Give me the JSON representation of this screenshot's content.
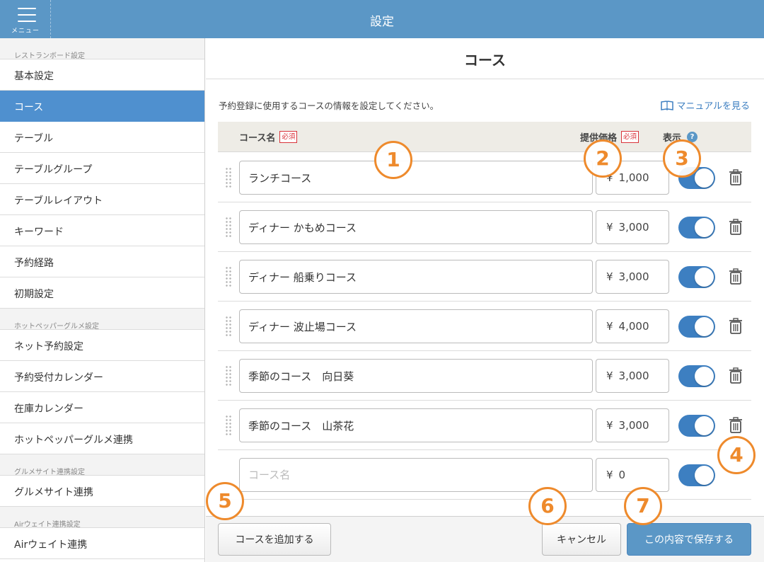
{
  "header": {
    "title": "設定",
    "menu_label": "メニュー"
  },
  "sidebar": {
    "groups": [
      {
        "section": "レストランボード設定",
        "items": [
          "基本設定",
          "コース",
          "テーブル",
          "テーブルグループ",
          "テーブルレイアウト",
          "キーワード",
          "予約経路",
          "初期設定"
        ]
      },
      {
        "section": "ホットペッパーグルメ設定",
        "items": [
          "ネット予約設定",
          "予約受付カレンダー",
          "在庫カレンダー",
          "ホットペッパーグルメ連携"
        ]
      },
      {
        "section": "グルメサイト連携設定",
        "items": [
          "グルメサイト連携"
        ]
      },
      {
        "section": "Airウェイト連携設定",
        "items": [
          "Airウェイト連携"
        ]
      }
    ],
    "active_item": "コース"
  },
  "main": {
    "title": "コース",
    "description": "予約登録に使用するコースの情報を設定してください。",
    "manual_link": "マニュアルを見る",
    "columns": {
      "name": "コース名",
      "price": "提供価格",
      "show": "表示",
      "required": "必須",
      "help": "?"
    },
    "currency": "¥",
    "courses": [
      {
        "name": "ランチコース",
        "price": "1,000",
        "visible": true
      },
      {
        "name": "ディナー かもめコース",
        "price": "3,000",
        "visible": true
      },
      {
        "name": "ディナー 船乗りコース",
        "price": "3,000",
        "visible": true
      },
      {
        "name": "ディナー 波止場コース",
        "price": "4,000",
        "visible": true
      },
      {
        "name": "季節のコース　向日葵",
        "price": "3,000",
        "visible": true
      },
      {
        "name": "季節のコース　山茶花",
        "price": "3,000",
        "visible": true
      }
    ],
    "new_course": {
      "placeholder": "コース名",
      "price": "0",
      "visible": true
    }
  },
  "footer": {
    "add_label": "コースを追加する",
    "cancel_label": "キャンセル",
    "save_label": "この内容で保存する"
  },
  "callouts": [
    "1",
    "2",
    "3",
    "4",
    "5",
    "6",
    "7"
  ],
  "colors": {
    "header": "#5b97c6",
    "active": "#4f90cf",
    "toggle_on": "#3d7fc1",
    "callout": "#ee8a2c",
    "required": "#d9333a"
  }
}
